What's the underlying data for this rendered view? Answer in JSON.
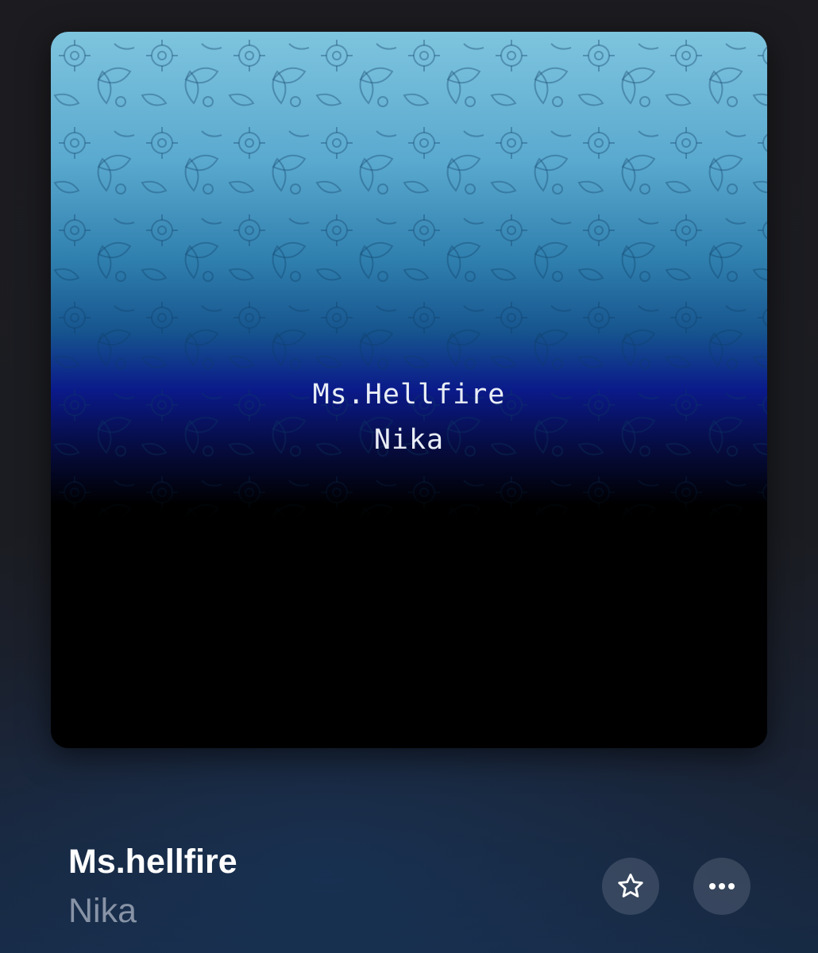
{
  "artwork": {
    "overlay_title": "Ms.Hellfire",
    "overlay_artist": "Nika",
    "colors": {
      "top": "#7ec4de",
      "mid": "#2f7fae",
      "deep": "#0a1a8a",
      "bottom": "#000000"
    }
  },
  "track": {
    "title": "Ms.hellfire",
    "artist": "Nika"
  },
  "actions": {
    "favorite_icon": "star-outline-icon",
    "more_icon": "ellipsis-icon"
  },
  "theme": {
    "title_color": "#ffffff",
    "artist_color": "#8893a6"
  }
}
